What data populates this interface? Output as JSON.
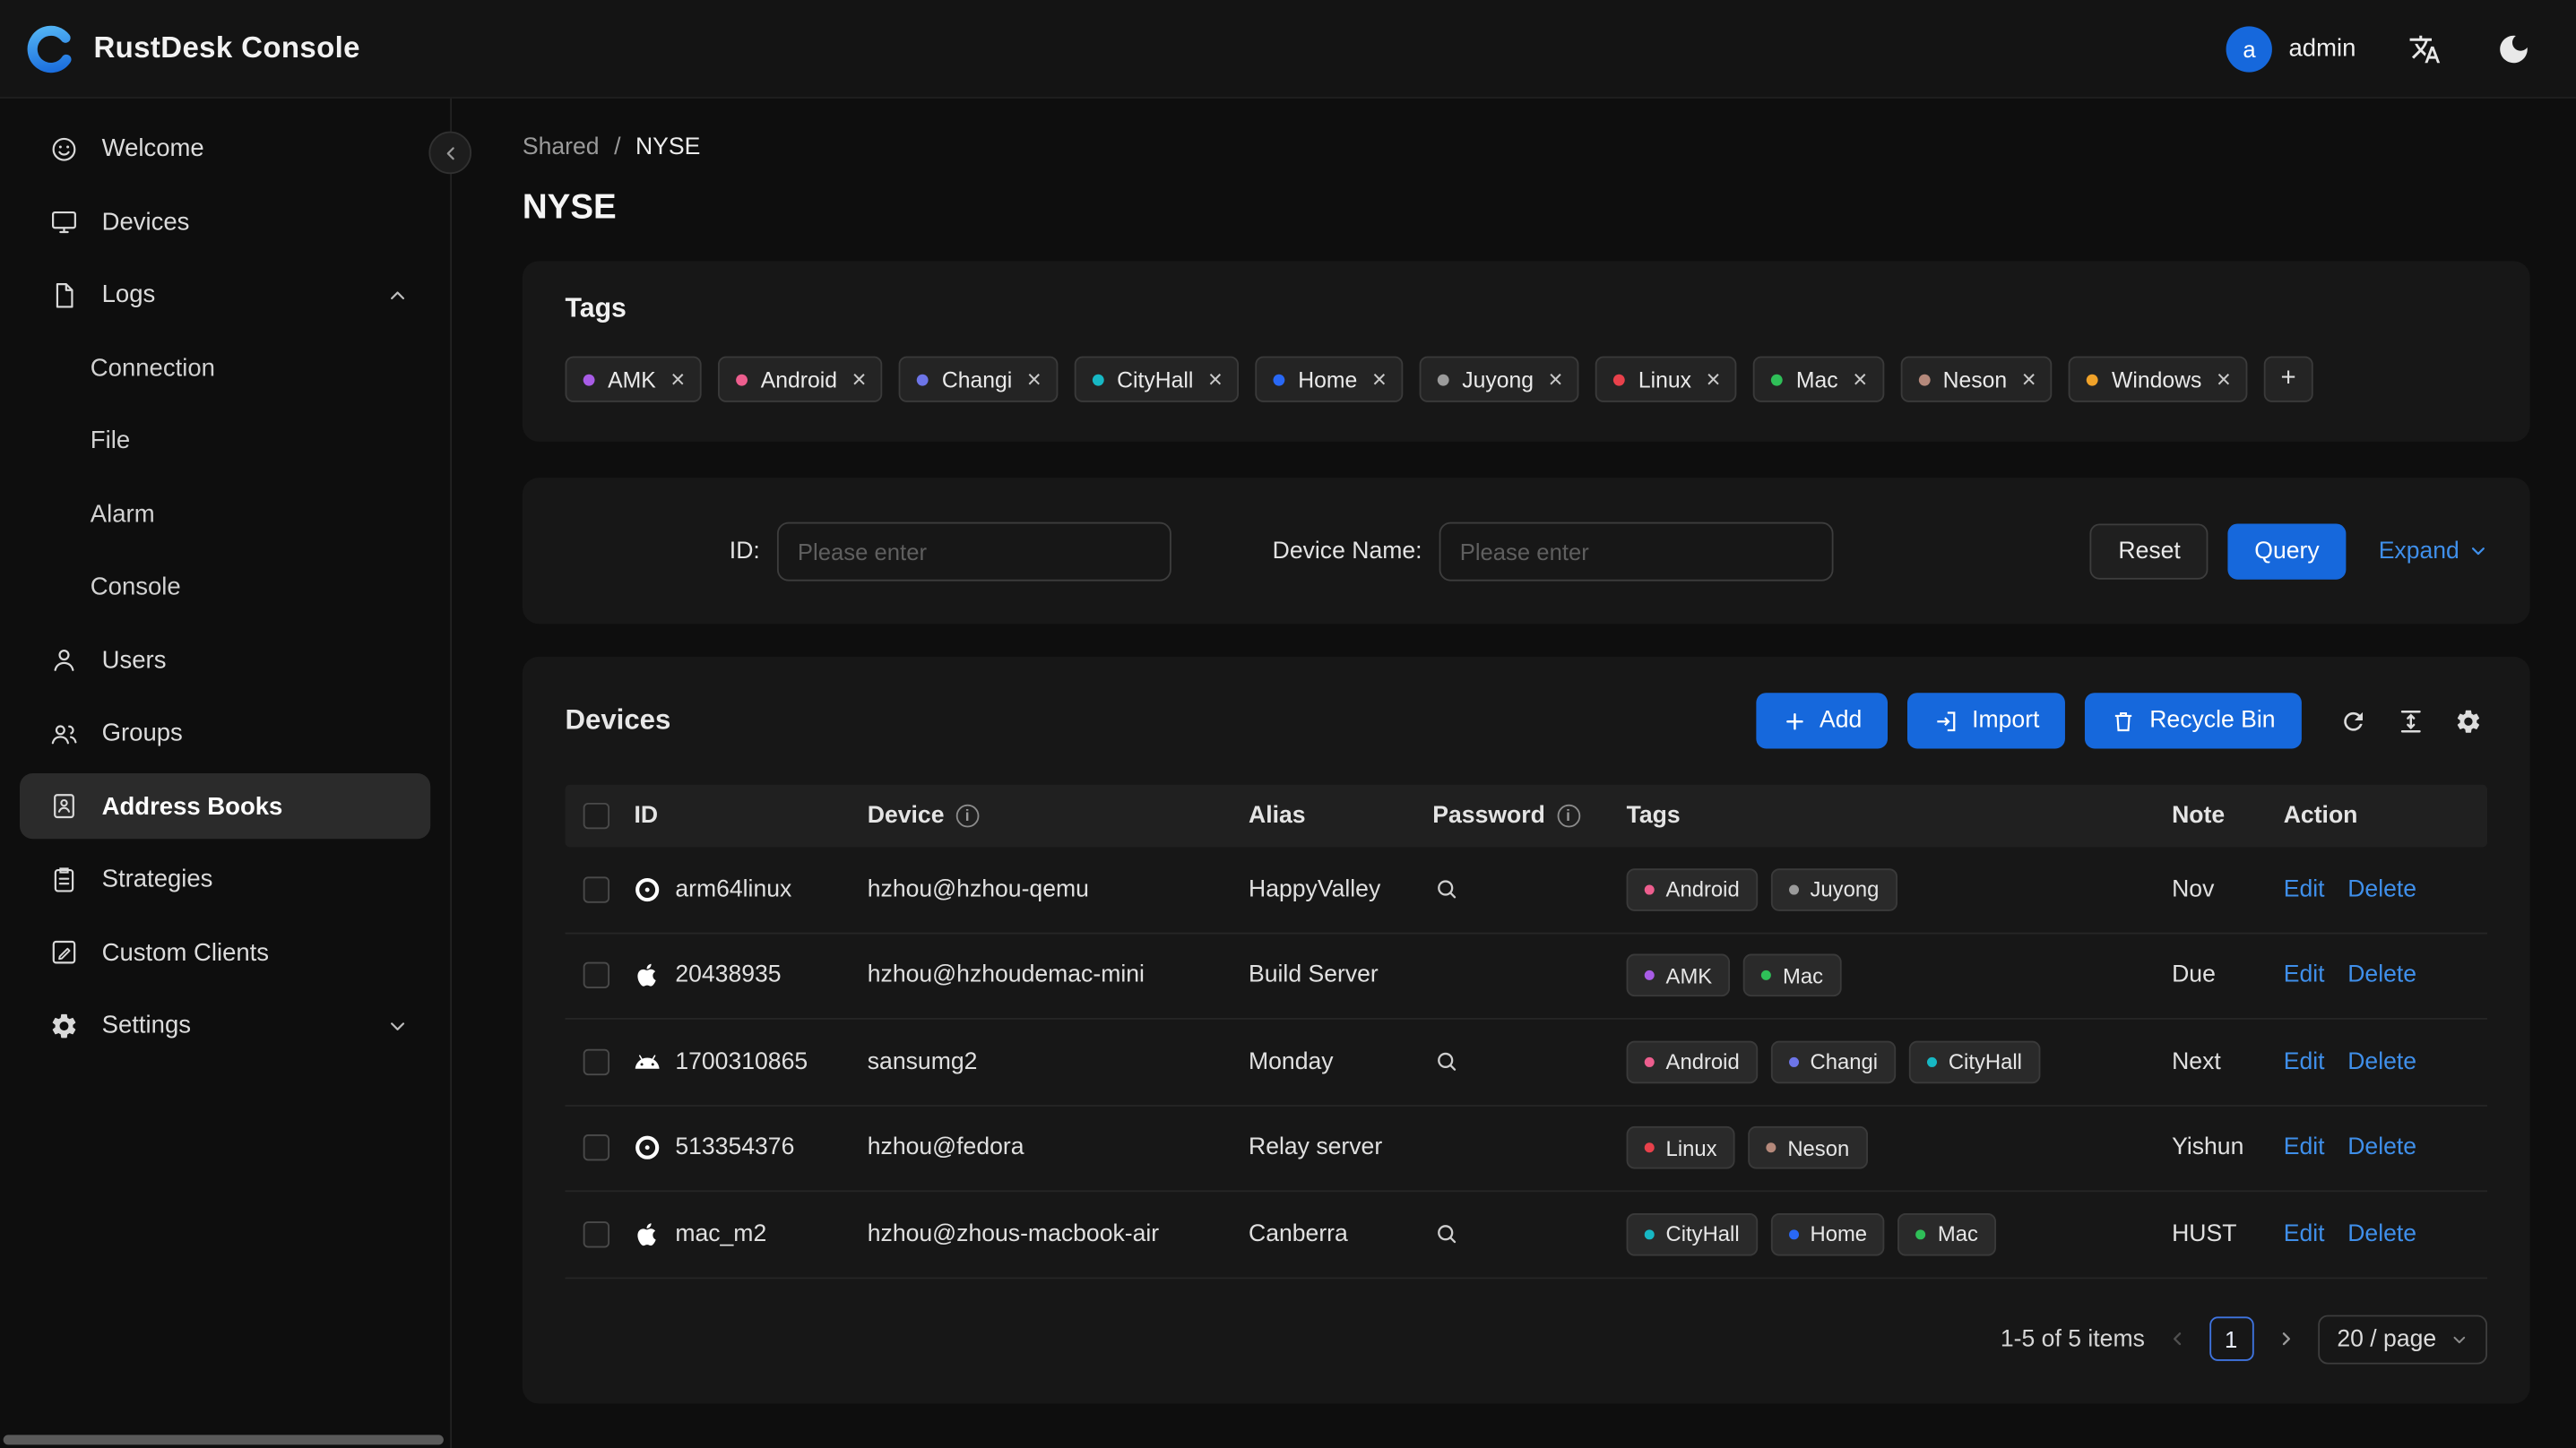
{
  "header": {
    "app_title": "RustDesk Console",
    "user": {
      "avatar_initial": "a",
      "name": "admin"
    }
  },
  "sidebar": {
    "items": [
      {
        "label": "Welcome",
        "icon": "smiley-icon"
      },
      {
        "label": "Devices",
        "icon": "monitor-icon"
      },
      {
        "label": "Logs",
        "icon": "file-icon",
        "expanded": true,
        "children": [
          {
            "label": "Connection"
          },
          {
            "label": "File"
          },
          {
            "label": "Alarm"
          },
          {
            "label": "Console"
          }
        ]
      },
      {
        "label": "Users",
        "icon": "user-icon"
      },
      {
        "label": "Groups",
        "icon": "users-icon"
      },
      {
        "label": "Address Books",
        "icon": "address-book-icon",
        "selected": true
      },
      {
        "label": "Strategies",
        "icon": "strategy-icon"
      },
      {
        "label": "Custom Clients",
        "icon": "custom-client-icon"
      },
      {
        "label": "Settings",
        "icon": "gear-icon",
        "expanded": false
      }
    ]
  },
  "breadcrumb": {
    "parent": "Shared",
    "separator": "/",
    "current": "NYSE"
  },
  "page": {
    "title": "NYSE"
  },
  "tags_card": {
    "title": "Tags",
    "add_button": "+",
    "tags": [
      {
        "label": "AMK",
        "color": "#a85ce6"
      },
      {
        "label": "Android",
        "color": "#ed5e8e"
      },
      {
        "label": "Changi",
        "color": "#6d75e8"
      },
      {
        "label": "CityHall",
        "color": "#17b8c4"
      },
      {
        "label": "Home",
        "color": "#2968f5"
      },
      {
        "label": "Juyong",
        "color": "#9b9b9b"
      },
      {
        "label": "Linux",
        "color": "#e8414b"
      },
      {
        "label": "Mac",
        "color": "#2fbf58"
      },
      {
        "label": "Neson",
        "color": "#b5897b"
      },
      {
        "label": "Windows",
        "color": "#f0a229"
      }
    ]
  },
  "filter": {
    "id_label": "ID:",
    "id_placeholder": "Please enter",
    "device_name_label": "Device Name:",
    "device_name_placeholder": "Please enter",
    "reset_button": "Reset",
    "query_button": "Query",
    "expand_link": "Expand"
  },
  "devices": {
    "title": "Devices",
    "add_button": "Add",
    "import_button": "Import",
    "recycle_bin_button": "Recycle Bin",
    "columns": {
      "id": "ID",
      "device": "Device",
      "alias": "Alias",
      "password": "Password",
      "tags": "Tags",
      "note": "Note",
      "action": "Action"
    },
    "actions": {
      "edit": "Edit",
      "delete": "Delete"
    },
    "rows": [
      {
        "os": "linux",
        "id": "arm64linux",
        "device": "hzhou@hzhou-qemu",
        "alias": "HappyValley",
        "has_password": true,
        "tags": [
          {
            "label": "Android",
            "color": "#ed5e8e"
          },
          {
            "label": "Juyong",
            "color": "#9b9b9b"
          }
        ],
        "note": "Nov"
      },
      {
        "os": "apple",
        "id": "20438935",
        "device": "hzhou@hzhoudemac-mini",
        "alias": "Build Server",
        "has_password": false,
        "tags": [
          {
            "label": "AMK",
            "color": "#a85ce6"
          },
          {
            "label": "Mac",
            "color": "#2fbf58"
          }
        ],
        "note": "Due"
      },
      {
        "os": "android",
        "id": "1700310865",
        "device": "sansumg2",
        "alias": "Monday",
        "has_password": true,
        "tags": [
          {
            "label": "Android",
            "color": "#ed5e8e"
          },
          {
            "label": "Changi",
            "color": "#6d75e8"
          },
          {
            "label": "CityHall",
            "color": "#17b8c4"
          }
        ],
        "note": "Next"
      },
      {
        "os": "linux",
        "id": "513354376",
        "device": "hzhou@fedora",
        "alias": "Relay server",
        "has_password": false,
        "tags": [
          {
            "label": "Linux",
            "color": "#e8414b"
          },
          {
            "label": "Neson",
            "color": "#b5897b"
          }
        ],
        "note": "Yishun"
      },
      {
        "os": "apple",
        "id": "mac_m2",
        "device": "hzhou@zhous-macbook-air",
        "alias": "Canberra",
        "has_password": true,
        "tags": [
          {
            "label": "CityHall",
            "color": "#17b8c4"
          },
          {
            "label": "Home",
            "color": "#2968f5"
          },
          {
            "label": "Mac",
            "color": "#2fbf58"
          }
        ],
        "note": "HUST"
      }
    ],
    "pagination": {
      "summary": "1-5 of 5 items",
      "current_page": "1",
      "page_size": "20 / page"
    }
  }
}
